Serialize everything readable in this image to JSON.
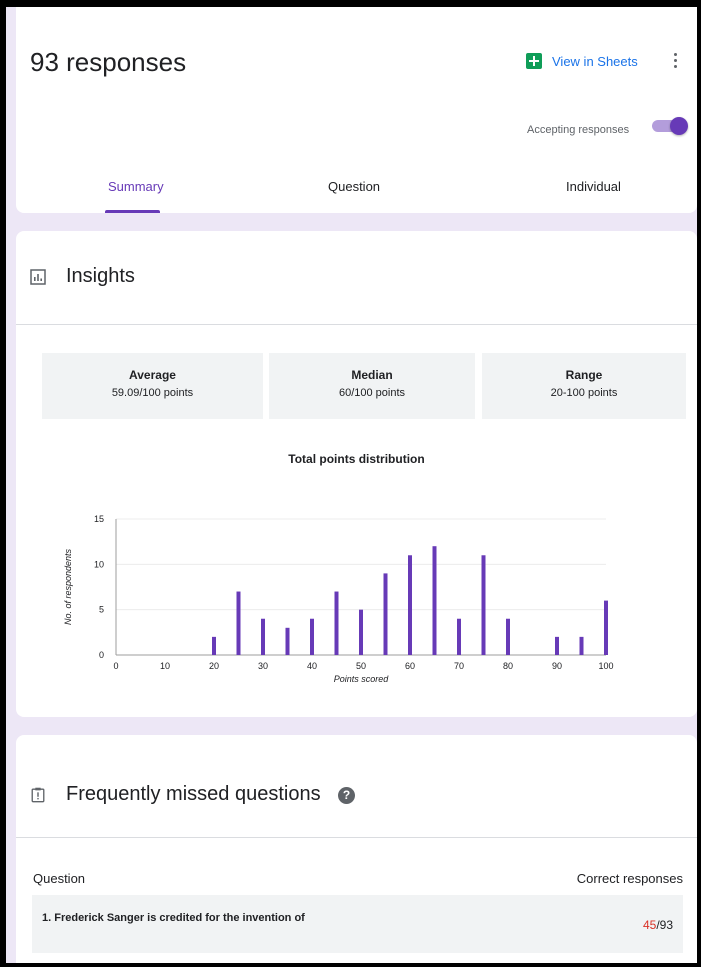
{
  "header": {
    "title": "93 responses",
    "sheets_label": "View in Sheets",
    "accepting_label": "Accepting responses",
    "accepting_on": true,
    "tabs": [
      {
        "label": "Summary",
        "active": true
      },
      {
        "label": "Question",
        "active": false
      },
      {
        "label": "Individual",
        "active": false
      }
    ]
  },
  "insights": {
    "title": "Insights",
    "stats": [
      {
        "label": "Average",
        "value": "59.09/100 points"
      },
      {
        "label": "Median",
        "value": "60/100 points"
      },
      {
        "label": "Range",
        "value": "20-100 points"
      }
    ]
  },
  "chart_data": {
    "type": "bar",
    "title": "Total points distribution",
    "xlabel": "Points scored",
    "ylabel": "No. of respondents",
    "x": [
      20,
      25,
      30,
      35,
      40,
      45,
      50,
      55,
      60,
      65,
      70,
      75,
      80,
      90,
      95,
      100
    ],
    "values": [
      2,
      7,
      4,
      3,
      4,
      7,
      5,
      9,
      11,
      12,
      4,
      11,
      4,
      2,
      2,
      6
    ],
    "xlim": [
      0,
      100
    ],
    "ylim": [
      0,
      15
    ],
    "x_ticks": [
      0,
      10,
      20,
      30,
      40,
      50,
      60,
      70,
      80,
      90,
      100
    ],
    "y_ticks": [
      0,
      5,
      10,
      15
    ],
    "grid": true,
    "bar_color": "#673ab7"
  },
  "missed": {
    "title": "Frequently missed questions",
    "col_question": "Question",
    "col_correct": "Correct responses",
    "rows": [
      {
        "question": "1. Frederick Sanger is credited for the invention of",
        "correct": "45",
        "total": "/93"
      }
    ]
  },
  "colors": {
    "accent": "#673ab7",
    "link": "#1a73e8",
    "sheets_green": "#0f9d58",
    "error_red": "#d93025",
    "background": "#ede7f6"
  }
}
